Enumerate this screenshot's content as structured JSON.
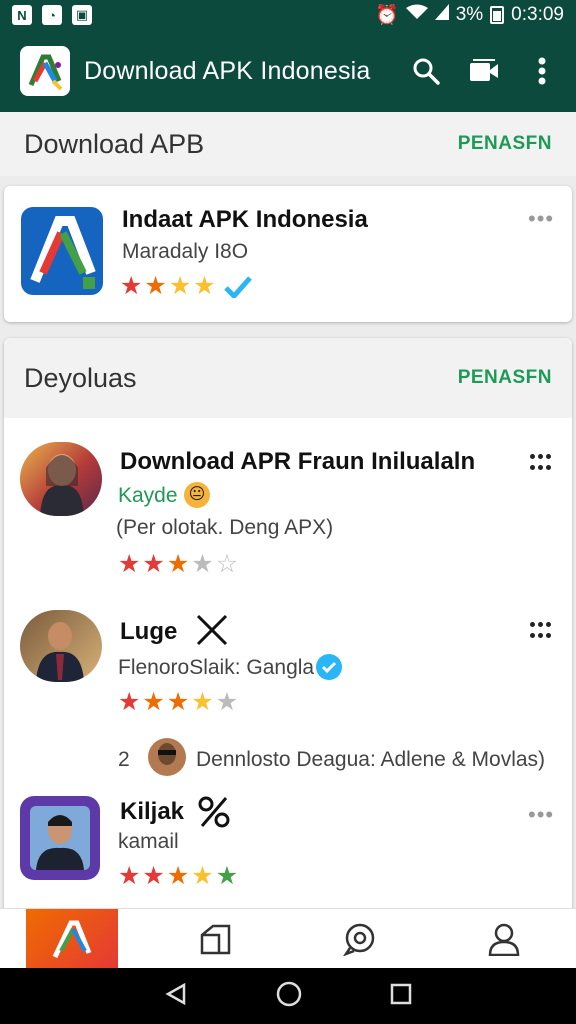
{
  "status_bar": {
    "battery": "3%",
    "time": "0:3:09"
  },
  "app_bar": {
    "title": "Download APK Indonesia"
  },
  "section1": {
    "title": "Download APB",
    "action": "PENASFN",
    "item": {
      "name": "Indaat APK Indonesia",
      "developer": "Maradaly I8O",
      "rating": 4
    }
  },
  "section2": {
    "title": "Deyoluas",
    "action": "PENASFN",
    "items": [
      {
        "name": "Download APR Fraun Inilualaln",
        "subtitle": "Kayde",
        "description": "(Per olotak. Deng APX)",
        "rating": 3
      },
      {
        "name": "Luge",
        "subtitle": "FlenoroSlaik: Gangla",
        "rating": 4
      },
      {
        "name": "Kiljak",
        "subtitle": "kamail",
        "rating": 5
      }
    ],
    "reply": {
      "count": "2",
      "text": "Dennlosto Deagua: Adlene & Movlas)"
    }
  },
  "colors": {
    "primary": "#0b4a3c",
    "accent": "#1e9a58",
    "star_filled": [
      "#e53935",
      "#ef6c00",
      "#fbc02d"
    ],
    "verified": "#29b6f6"
  }
}
